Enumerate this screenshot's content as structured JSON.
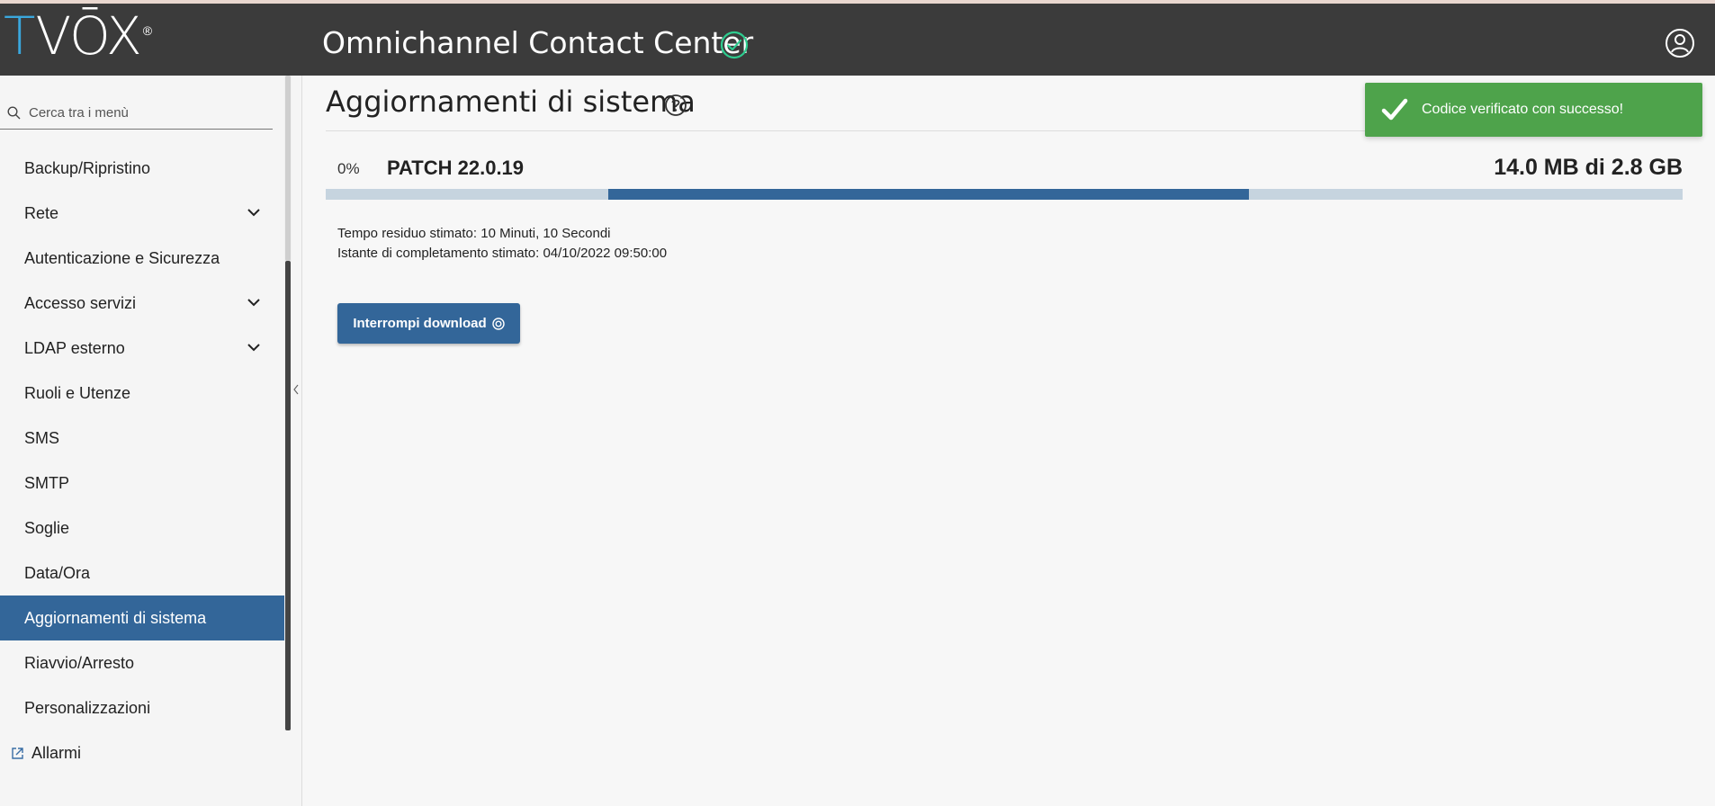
{
  "header": {
    "logo": {
      "t": "T",
      "vox": "VŌX",
      "reg": "®"
    },
    "app_title": "Omnichannel Contact Center",
    "status_icon": "check-circle-icon",
    "user_icon": "user-circle-icon",
    "status_color": "#2ecc8f"
  },
  "sidebar": {
    "search_placeholder": "Cerca tra i menù",
    "items": [
      {
        "label": "Backup/Ripristino",
        "expandable": false
      },
      {
        "label": "Rete",
        "expandable": true
      },
      {
        "label": "Autenticazione e Sicurezza",
        "expandable": false
      },
      {
        "label": "Accesso servizi",
        "expandable": true
      },
      {
        "label": "LDAP esterno",
        "expandable": true
      },
      {
        "label": "Ruoli e Utenze",
        "expandable": false
      },
      {
        "label": "SMS",
        "expandable": false
      },
      {
        "label": "SMTP",
        "expandable": false
      },
      {
        "label": "Soglie",
        "expandable": false
      },
      {
        "label": "Data/Ora",
        "expandable": false
      },
      {
        "label": "Aggiornamenti di sistema",
        "expandable": false,
        "active": true
      },
      {
        "label": "Riavvio/Arresto",
        "expandable": false
      },
      {
        "label": "Personalizzazioni",
        "expandable": false
      },
      {
        "label": "Allarmi",
        "external": true
      }
    ]
  },
  "main": {
    "title": "Aggiornamenti di sistema",
    "download": {
      "percent_label": "0%",
      "patch_name": "PATCH 22.0.19",
      "size_label": "14.0 MB di 2.8 GB",
      "indeterminate_segment": {
        "start": 0.208,
        "end": 0.68
      }
    },
    "eta": "Tempo residuo stimato: 10 Minuti, 10 Secondi",
    "completion": "Istante di completamento stimato: 04/10/2022 09:50:00",
    "stop_button": "Interrompi download"
  },
  "toast": {
    "message": "Codice verificato con successo!",
    "color": "#4ea34b"
  },
  "colors": {
    "accent": "#336699",
    "topbar": "#3b3b3b",
    "logo_blue": "#3aa7dd"
  }
}
